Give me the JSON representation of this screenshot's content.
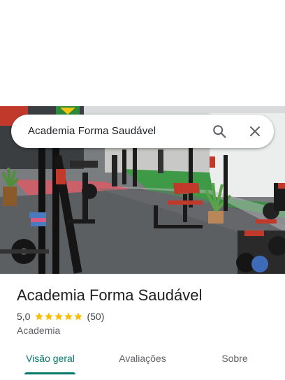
{
  "search": {
    "query": "Academia Forma Saudável"
  },
  "place": {
    "name": "Academia Forma Saudável",
    "rating": "5,0",
    "stars": 5,
    "review_count": "(50)",
    "category": "Academia"
  },
  "tabs": [
    {
      "label": "Visão geral",
      "active": true
    },
    {
      "label": "Avaliações",
      "active": false
    },
    {
      "label": "Sobre",
      "active": false
    }
  ],
  "colors": {
    "accent": "#00796b",
    "star": "#fbbc04"
  },
  "icons": {
    "search": "search-icon",
    "close": "close-icon",
    "star": "star-icon"
  }
}
